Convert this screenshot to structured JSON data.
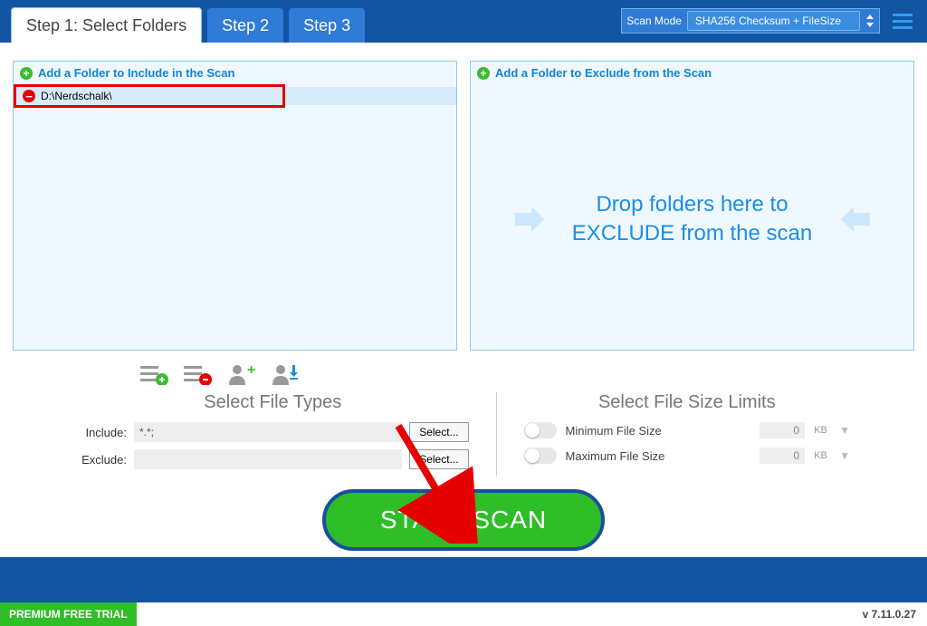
{
  "tabs": {
    "t1": "Step 1: Select Folders",
    "t2": "Step 2",
    "t3": "Step 3"
  },
  "scanmode": {
    "label": "Scan Mode",
    "value": "SHA256 Checksum + FileSize"
  },
  "include_panel": {
    "header": "Add a Folder to Include in the Scan",
    "folder1": "D:\\Nerdschalk\\"
  },
  "exclude_panel": {
    "header": "Add a Folder to Exclude from the Scan",
    "droptext": "Drop folders here to EXCLUDE from the scan"
  },
  "filetypes": {
    "title": "Select File Types",
    "include_label": "Include:",
    "include_value": "*.*;",
    "exclude_label": "Exclude:",
    "exclude_value": "",
    "select_btn": "Select..."
  },
  "filesize": {
    "title": "Select File Size Limits",
    "min_label": "Minimum File Size",
    "max_label": "Maximum File Size",
    "min_val": "0",
    "max_val": "0",
    "unit": "KB"
  },
  "start_btn": "START SCAN",
  "footer": {
    "trial": "PREMIUM FREE TRIAL",
    "version": "v 7.11.0.27"
  }
}
